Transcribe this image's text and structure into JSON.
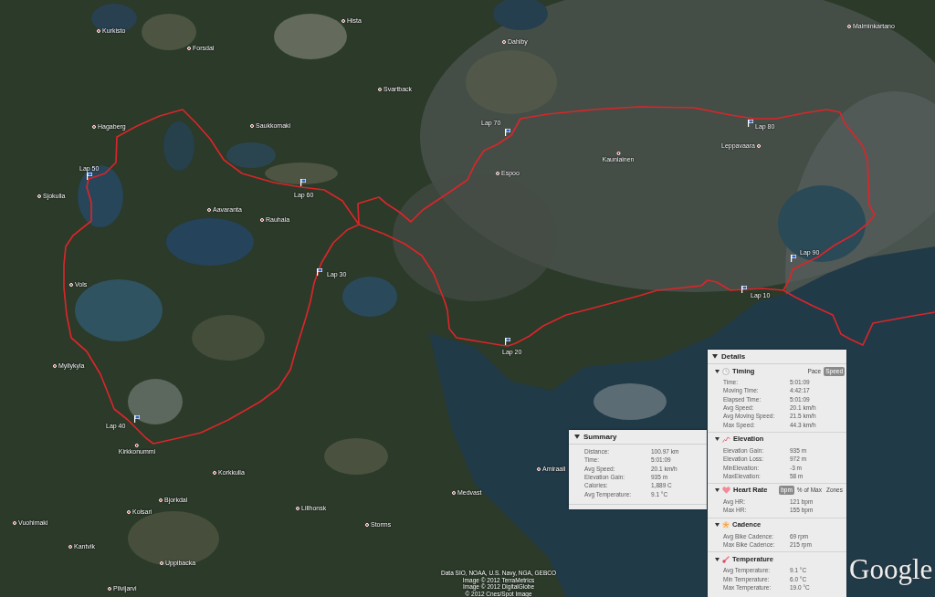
{
  "map": {
    "places": [
      "Hista",
      "Malminkartano",
      "Kurkisto",
      "Dahlby",
      "Forsdal",
      "Svartback",
      "Hagaberg",
      "Saukkomaki",
      "Leppavaara",
      "Kauniainen",
      "Espoo",
      "Sjokulla",
      "Aavaranta",
      "Rauhala",
      "Vols",
      "Myllykyla",
      "Kirkkonummi",
      "Amiraali",
      "Korkkulla",
      "Medvast",
      "Bjorkdal",
      "Lillhonsk",
      "Kolsari",
      "Vuohimaki",
      "Storms",
      "Kantvik",
      "Uppibacka",
      "Pilvijarvi"
    ],
    "laps": [
      "Lap 70",
      "Lap 80",
      "Lap 50",
      "Lap 60",
      "Lap 90",
      "Lap 30",
      "Lap 10",
      "Lap 20",
      "Lap 40"
    ],
    "attribution": [
      "Data SIO, NOAA, U.S. Navy, NGA, GEBCO",
      "Image © 2012 TerraMetrics",
      "Image © 2012 DigitalGlobe",
      "© 2012 Cnes/Spot Image"
    ],
    "logo": "Google"
  },
  "summary": {
    "title": "Summary",
    "expanded": true,
    "rows": [
      {
        "label": "Distance:",
        "value": "100.97 km"
      },
      {
        "label": "Time:",
        "value": "5:01:09"
      },
      {
        "label": "Avg Speed:",
        "value": "20.1 km/h"
      },
      {
        "label": "Elevation Gain:",
        "value": "935 m"
      },
      {
        "label": "Calories:",
        "value": "1,889 C"
      },
      {
        "label": "Avg Temperature:",
        "value": "9.1 °C"
      }
    ]
  },
  "details": {
    "title": "Details",
    "expanded": true,
    "sections": [
      {
        "kind": "timing",
        "title": "Timing",
        "expanded": true,
        "toggles": [
          {
            "label": "Pace",
            "selected": false
          },
          {
            "label": "Speed",
            "selected": true
          }
        ],
        "rows": [
          {
            "label": "Time:",
            "value": "5:01:09"
          },
          {
            "label": "Moving Time:",
            "value": "4:42:17"
          },
          {
            "label": "Elapsed Time:",
            "value": "5:01:09"
          },
          {
            "label": "Avg Speed:",
            "value": "20.1 km/h"
          },
          {
            "label": "Avg Moving Speed:",
            "value": "21.5 km/h"
          },
          {
            "label": "Max Speed:",
            "value": "44.3 km/h"
          }
        ]
      },
      {
        "kind": "elevation",
        "title": "Elevation",
        "expanded": true,
        "rows": [
          {
            "label": "Elevation Gain:",
            "value": "935 m"
          },
          {
            "label": "Elevation Loss:",
            "value": "972 m"
          },
          {
            "label": "MinElevation:",
            "value": "-3 m"
          },
          {
            "label": "MaxElevation:",
            "value": "58 m"
          }
        ]
      },
      {
        "kind": "heart_rate",
        "title": "Heart Rate",
        "expanded": true,
        "toggles": [
          {
            "label": "bpm",
            "selected": true
          },
          {
            "label": "% of Max",
            "selected": false
          },
          {
            "label": "Zones",
            "selected": false
          }
        ],
        "rows": [
          {
            "label": "Avg HR:",
            "value": "121 bpm"
          },
          {
            "label": "Max HR:",
            "value": "155 bpm"
          }
        ]
      },
      {
        "kind": "cadence",
        "title": "Cadence",
        "expanded": true,
        "rows": [
          {
            "label": "Avg Bike Cadence:",
            "value": "69 rpm"
          },
          {
            "label": "Max Bike Cadence:",
            "value": "215 rpm"
          }
        ]
      },
      {
        "kind": "temperature",
        "title": "Temperature",
        "expanded": true,
        "rows": [
          {
            "label": "Avg Temperature:",
            "value": "9.1 °C"
          },
          {
            "label": "Min Temperature:",
            "value": "6.0 °C"
          },
          {
            "label": "Max Temperature:",
            "value": "19.0 °C"
          }
        ]
      }
    ]
  }
}
